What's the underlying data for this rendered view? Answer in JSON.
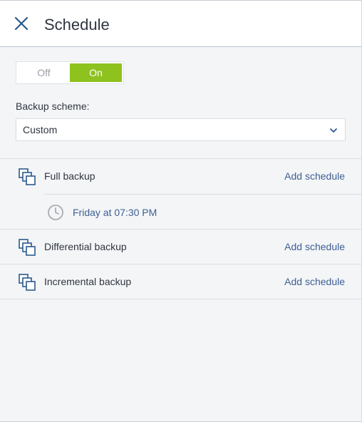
{
  "header": {
    "title": "Schedule"
  },
  "toggle": {
    "off_label": "Off",
    "on_label": "On",
    "state": "on"
  },
  "scheme": {
    "label": "Backup scheme:",
    "value": "Custom"
  },
  "backups": [
    {
      "name": "Full backup",
      "action": "Add schedule",
      "schedule": "Friday at 07:30 PM"
    },
    {
      "name": "Differential backup",
      "action": "Add schedule"
    },
    {
      "name": "Incremental backup",
      "action": "Add schedule"
    }
  ],
  "colors": {
    "accent": "#8dc21f",
    "link": "#3d5f93",
    "icon": "#2b5a8c"
  }
}
